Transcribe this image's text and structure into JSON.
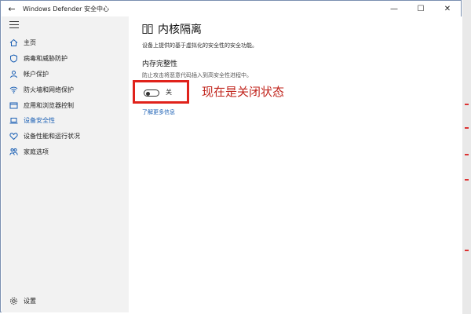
{
  "window": {
    "title": "Windows Defender 安全中心",
    "back_icon": "back-arrow-icon",
    "minimize_glyph": "—",
    "maximize_glyph": "☐",
    "close_glyph": "✕"
  },
  "sidebar": {
    "menu_icon": "hamburger-icon",
    "items": [
      {
        "label": "主页",
        "icon": "home-icon"
      },
      {
        "label": "病毒和威胁防护",
        "icon": "shield-icon"
      },
      {
        "label": "帐户保护",
        "icon": "person-icon"
      },
      {
        "label": "防火墙和网络保护",
        "icon": "wifi-icon"
      },
      {
        "label": "应用和浏览器控制",
        "icon": "window-icon"
      },
      {
        "label": "设备安全性",
        "icon": "laptop-icon",
        "active": true
      },
      {
        "label": "设备性能和运行状况",
        "icon": "heart-icon"
      },
      {
        "label": "家庭选项",
        "icon": "family-icon"
      }
    ],
    "settings_label": "设置",
    "settings_icon": "gear-icon"
  },
  "main": {
    "title": "内核隔离",
    "title_icon": "core-isolation-icon",
    "description": "设备上提供的基于虚拟化的安全性的安全功能。",
    "section_title": "内存完整性",
    "section_description": "防止攻击将恶意代码插入到高安全性进程中。",
    "toggle": {
      "state": "off",
      "label": "关"
    },
    "learn_more": "了解更多信息"
  },
  "annotation": {
    "text": "现在是关闭状态",
    "color": "#c0231b",
    "box_color": "#e0221b"
  },
  "accent_color": "#1a5fb4"
}
